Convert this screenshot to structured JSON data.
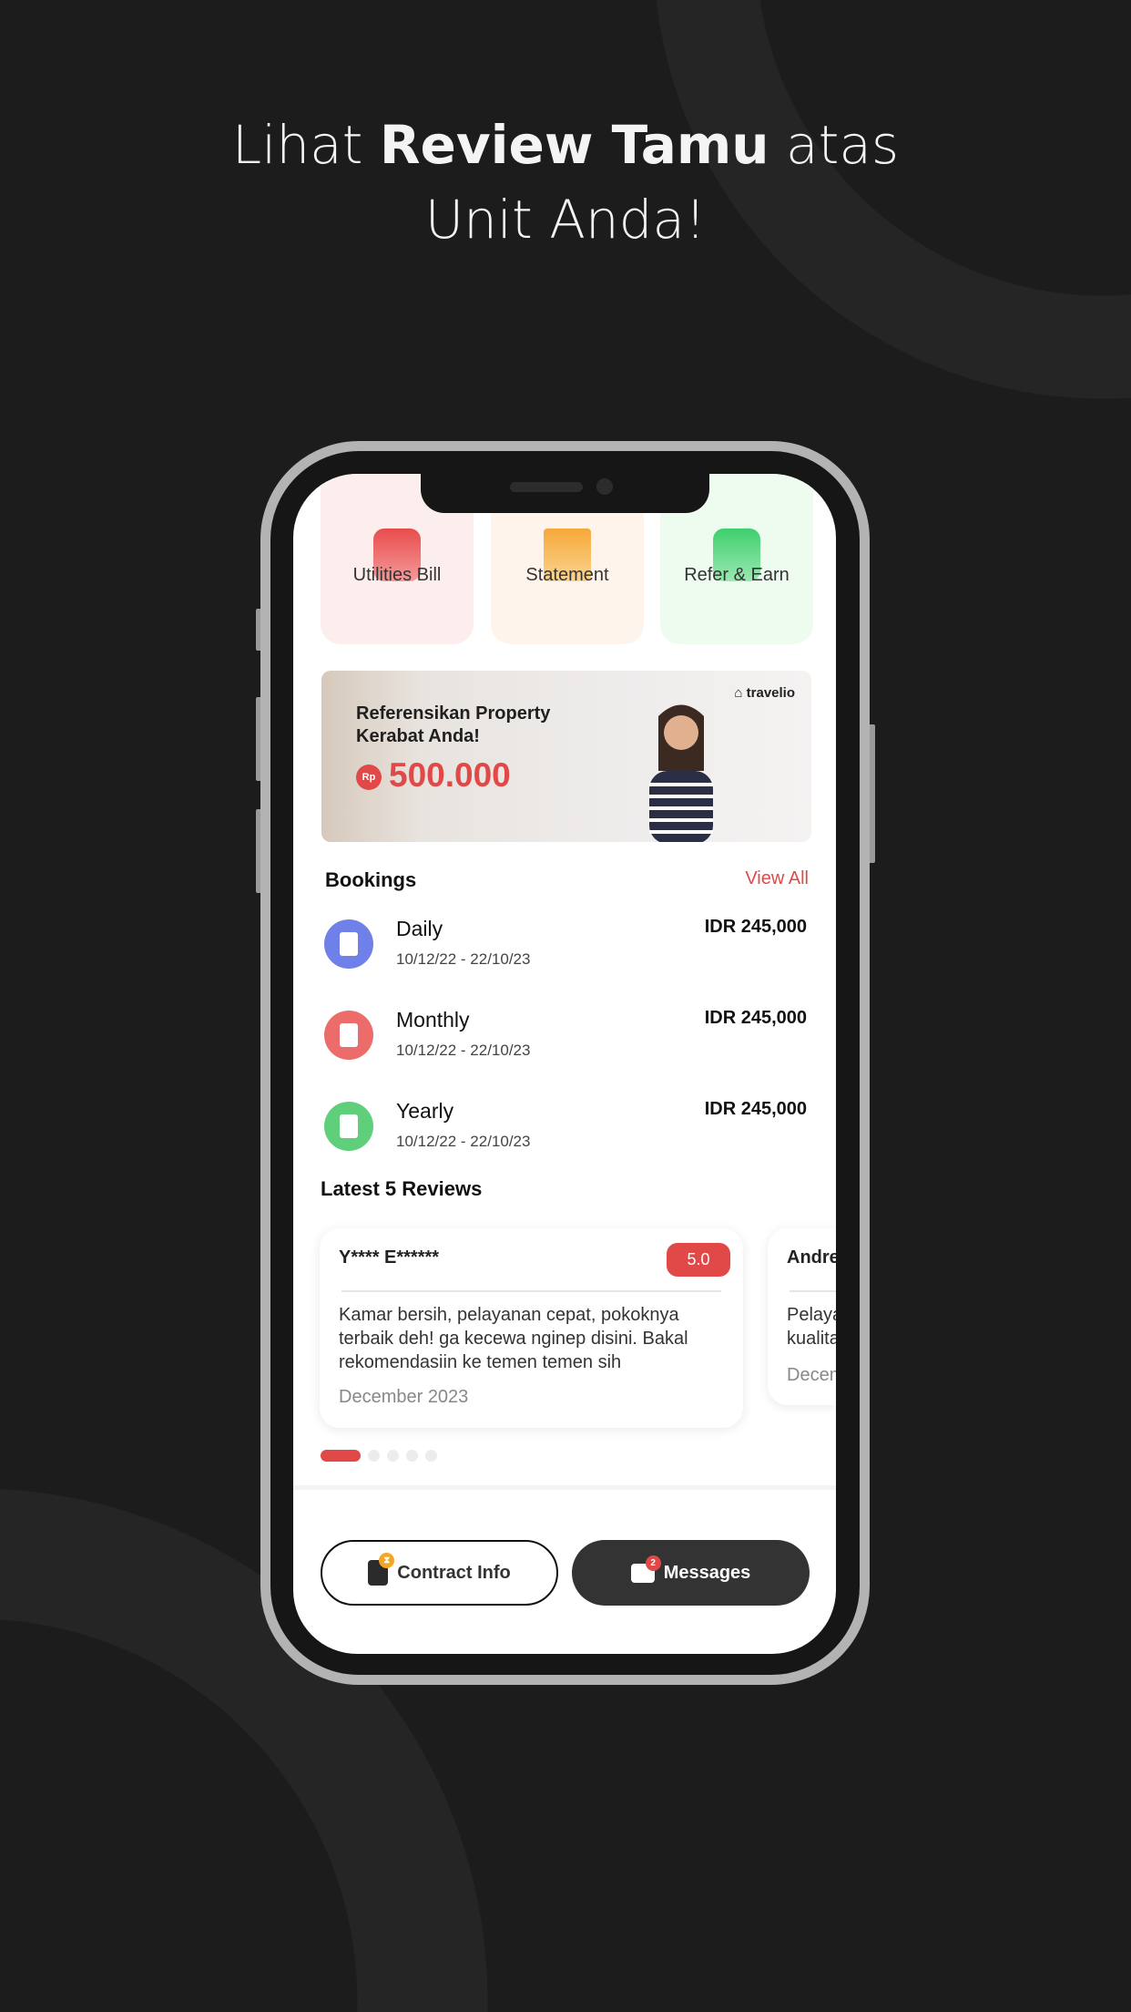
{
  "headline": {
    "pre": "Lihat ",
    "bold": "Review Tamu",
    "post": " atas",
    "line2": "Unit Anda!"
  },
  "quick_actions": [
    {
      "label": "Utilities Bill",
      "icon": "bill-icon",
      "color": "#ec5a5a",
      "bg": "#fdeeee"
    },
    {
      "label": "Statement",
      "icon": "book-icon",
      "color": "#f6b24c",
      "bg": "#fff4ec"
    },
    {
      "label": "Refer & Earn",
      "icon": "wallet-icon",
      "color": "#56d47b",
      "bg": "#eefcf0"
    }
  ],
  "banner": {
    "title1": "Referensikan Property",
    "title2": "Kerabat Anda!",
    "currency": "Rp",
    "amount": "500.000",
    "logo": "travelio"
  },
  "bookings": {
    "title": "Bookings",
    "view_all": "View All",
    "items": [
      {
        "name": "Daily",
        "date": "10/12/22 - 22/10/23",
        "price": "IDR 245,000",
        "color": "#6f80e8"
      },
      {
        "name": "Monthly",
        "date": "10/12/22 - 22/10/23",
        "price": "IDR 245,000",
        "color": "#ec6b6b"
      },
      {
        "name": "Yearly",
        "date": "10/12/22 - 22/10/23",
        "price": "IDR 245,000",
        "color": "#5fcf7b"
      }
    ]
  },
  "reviews": {
    "title": "Latest 5 Reviews",
    "items": [
      {
        "name": "Y**** E******",
        "score": "5.0",
        "text": "Kamar bersih, pelayanan cepat, pokoknya terbaik deh! ga kecewa nginep disini. Bakal rekomendasiin ke temen temen sih",
        "date": "December 2023"
      },
      {
        "name": "Andre",
        "text": "Pelaya kualita",
        "date": "Decem"
      }
    ],
    "active_page": 1,
    "page_count": 5
  },
  "actions": {
    "contract": "Contract Info",
    "messages": "Messages",
    "messages_badge": "2"
  },
  "colors": {
    "accent": "#e14848",
    "background": "#1c1c1c"
  }
}
